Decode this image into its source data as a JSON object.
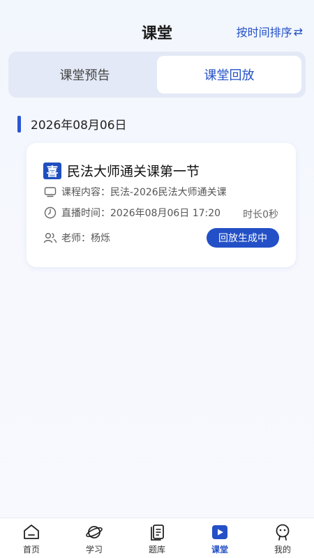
{
  "header": {
    "title": "课堂",
    "sort_label": "按时间排序",
    "sort_icon": "swap-arrows-icon"
  },
  "tabs": [
    {
      "label": "课堂预告",
      "active": false
    },
    {
      "label": "课堂回放",
      "active": true
    }
  ],
  "date_group": {
    "date": "2026年08月06日"
  },
  "card": {
    "logo_text": "喜",
    "title": "民法大师通关课第一节",
    "content_label": "课程内容：",
    "content_value": "民法-2026民法大师通关课",
    "time_label": "直播时间：",
    "time_value": "2026年08月06日 17:20",
    "duration": "时长0秒",
    "teacher_label": "老师：",
    "teacher_value": "杨烁",
    "replay_button": "回放生成中"
  },
  "tabbar": [
    {
      "label": "首页",
      "icon": "home-icon",
      "active": false
    },
    {
      "label": "学习",
      "icon": "planet-icon",
      "active": false
    },
    {
      "label": "题库",
      "icon": "question-bank-icon",
      "active": false
    },
    {
      "label": "课堂",
      "icon": "classroom-play-icon",
      "active": true
    },
    {
      "label": "我的",
      "icon": "profile-icon",
      "active": false
    }
  ],
  "colors": {
    "accent": "#2350c7",
    "tab_bg": "#e3e9f6",
    "date_bar": "#2a56d4"
  }
}
